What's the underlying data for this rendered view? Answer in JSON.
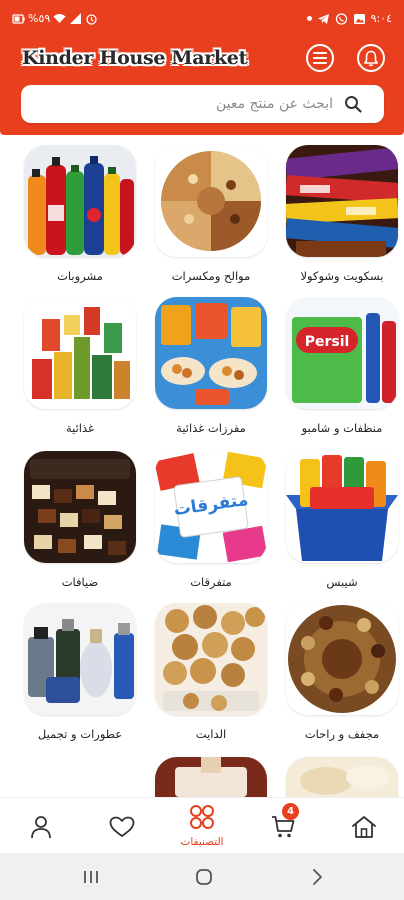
{
  "status_bar": {
    "left_text": "%٥٩",
    "time": "٩:٠٤"
  },
  "header": {
    "brand": "Kinder House Market"
  },
  "search": {
    "placeholder": "ابحث عن منتج معين",
    "value": ""
  },
  "categories": [
    {
      "label": "مشروبات"
    },
    {
      "label": "موالح ومكسرات"
    },
    {
      "label": "بسكويت وشوكولا"
    },
    {
      "label": "غذائية"
    },
    {
      "label": "مفرزات غذائية"
    },
    {
      "label": "منظفات و شامبو"
    },
    {
      "label": "ضيافات"
    },
    {
      "label": "متفرقات",
      "image_text": "متفرقات"
    },
    {
      "label": "شيبس"
    },
    {
      "label": "عطورات و تجميل"
    },
    {
      "label": "الدايت"
    },
    {
      "label": "مجفف و راحات"
    }
  ],
  "bottom_nav": {
    "categories_label": "التصنيفات",
    "cart_count": "4"
  },
  "colors": {
    "brand": "#e8401f"
  }
}
